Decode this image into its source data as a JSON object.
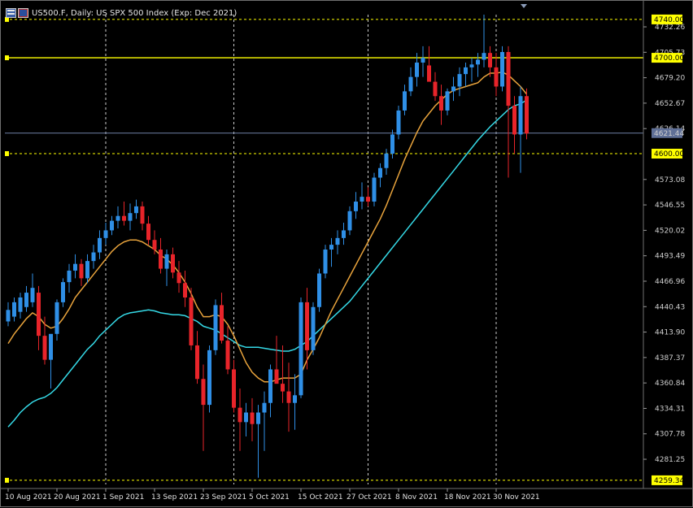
{
  "window": {
    "title": "US500.F, Daily:  US SPX 500 Index (Exp: Dec 2021)",
    "icon": "chart-window-icon"
  },
  "colors": {
    "background": "#000000",
    "bull_candle": "#2f8fe6",
    "bear_candle": "#e8242a",
    "ma_fast": "#e8a33c",
    "ma_slow": "#35d9e6",
    "level_line": "#ffff00",
    "grid": "#ffffff",
    "price_line": "#6f7fa6",
    "axis_text": "#cfcfcf"
  },
  "levels": [
    {
      "name": "level-4740",
      "value": 4740.0,
      "label": "4740.00",
      "style": "dashed"
    },
    {
      "name": "level-4700",
      "value": 4700.0,
      "label": "4700.00",
      "style": "solid"
    },
    {
      "name": "level-4600",
      "value": 4600.0,
      "label": "4600.00",
      "style": "dashed"
    },
    {
      "name": "level-4259",
      "value": 4259.34,
      "label": "4259.34",
      "style": "dashed"
    }
  ],
  "current_price": {
    "value": 4621.44,
    "label": "4621.44"
  },
  "chart_data": {
    "type": "candlestick",
    "title": "US500.F, Daily:  US SPX 500 Index (Exp: Dec 2021)",
    "grid": true,
    "ylim": [
      4255,
      4745
    ],
    "y_ticks": [
      "4732.26",
      "4705.73",
      "4679.20",
      "4652.67",
      "4626.14",
      "4573.08",
      "4546.55",
      "4520.02",
      "4493.49",
      "4466.96",
      "4440.43",
      "4413.90",
      "4387.37",
      "4360.84",
      "4334.31",
      "4307.78",
      "4281.25"
    ],
    "x_ticks": [
      "10 Aug 2021",
      "20 Aug 2021",
      "1 Sep 2021",
      "13 Sep 2021",
      "23 Sep 2021",
      "5 Oct 2021",
      "15 Oct 2021",
      "27 Oct 2021",
      "8 Nov 2021",
      "18 Nov 2021",
      "30 Nov 2021"
    ],
    "x_tick_index": [
      0,
      8,
      16,
      24,
      32,
      40,
      48,
      56,
      64,
      72,
      80
    ],
    "vertical_grid_index": [
      16,
      37,
      59,
      80
    ],
    "candles": [
      {
        "o": 4425,
        "h": 4445,
        "l": 4420,
        "c": 4437
      },
      {
        "o": 4430,
        "h": 4450,
        "l": 4425,
        "c": 4445
      },
      {
        "o": 4435,
        "h": 4455,
        "l": 4428,
        "c": 4450
      },
      {
        "o": 4440,
        "h": 4462,
        "l": 4435,
        "c": 4455
      },
      {
        "o": 4445,
        "h": 4475,
        "l": 4440,
        "c": 4460
      },
      {
        "o": 4455,
        "h": 4462,
        "l": 4395,
        "c": 4410
      },
      {
        "o": 4410,
        "h": 4430,
        "l": 4380,
        "c": 4385
      },
      {
        "o": 4385,
        "h": 4400,
        "l": 4355,
        "c": 4412
      },
      {
        "o": 4412,
        "h": 4448,
        "l": 4405,
        "c": 4445
      },
      {
        "o": 4445,
        "h": 4470,
        "l": 4440,
        "c": 4466
      },
      {
        "o": 4466,
        "h": 4485,
        "l": 4455,
        "c": 4478
      },
      {
        "o": 4478,
        "h": 4495,
        "l": 4470,
        "c": 4485
      },
      {
        "o": 4485,
        "h": 4490,
        "l": 4462,
        "c": 4470
      },
      {
        "o": 4470,
        "h": 4495,
        "l": 4465,
        "c": 4488
      },
      {
        "o": 4488,
        "h": 4505,
        "l": 4480,
        "c": 4497
      },
      {
        "o": 4497,
        "h": 4520,
        "l": 4490,
        "c": 4512
      },
      {
        "o": 4512,
        "h": 4528,
        "l": 4505,
        "c": 4520
      },
      {
        "o": 4520,
        "h": 4535,
        "l": 4515,
        "c": 4530
      },
      {
        "o": 4530,
        "h": 4545,
        "l": 4522,
        "c": 4535
      },
      {
        "o": 4535,
        "h": 4550,
        "l": 4525,
        "c": 4530
      },
      {
        "o": 4530,
        "h": 4548,
        "l": 4520,
        "c": 4538
      },
      {
        "o": 4538,
        "h": 4552,
        "l": 4532,
        "c": 4545
      },
      {
        "o": 4545,
        "h": 4550,
        "l": 4520,
        "c": 4527
      },
      {
        "o": 4527,
        "h": 4535,
        "l": 4505,
        "c": 4510
      },
      {
        "o": 4510,
        "h": 4520,
        "l": 4495,
        "c": 4500
      },
      {
        "o": 4500,
        "h": 4512,
        "l": 4475,
        "c": 4480
      },
      {
        "o": 4480,
        "h": 4500,
        "l": 4462,
        "c": 4495
      },
      {
        "o": 4495,
        "h": 4502,
        "l": 4470,
        "c": 4476
      },
      {
        "o": 4476,
        "h": 4488,
        "l": 4455,
        "c": 4465
      },
      {
        "o": 4465,
        "h": 4478,
        "l": 4440,
        "c": 4450
      },
      {
        "o": 4450,
        "h": 4460,
        "l": 4395,
        "c": 4400
      },
      {
        "o": 4400,
        "h": 4415,
        "l": 4360,
        "c": 4365
      },
      {
        "o": 4365,
        "h": 4380,
        "l": 4290,
        "c": 4338
      },
      {
        "o": 4338,
        "h": 4400,
        "l": 4330,
        "c": 4395
      },
      {
        "o": 4395,
        "h": 4448,
        "l": 4390,
        "c": 4442
      },
      {
        "o": 4442,
        "h": 4455,
        "l": 4402,
        "c": 4405
      },
      {
        "o": 4405,
        "h": 4420,
        "l": 4370,
        "c": 4375
      },
      {
        "o": 4375,
        "h": 4385,
        "l": 4330,
        "c": 4335
      },
      {
        "o": 4335,
        "h": 4355,
        "l": 4290,
        "c": 4320
      },
      {
        "o": 4320,
        "h": 4340,
        "l": 4305,
        "c": 4330
      },
      {
        "o": 4330,
        "h": 4345,
        "l": 4300,
        "c": 4318
      },
      {
        "o": 4318,
        "h": 4338,
        "l": 4262,
        "c": 4330
      },
      {
        "o": 4330,
        "h": 4352,
        "l": 4290,
        "c": 4340
      },
      {
        "o": 4340,
        "h": 4380,
        "l": 4325,
        "c": 4375
      },
      {
        "o": 4375,
        "h": 4410,
        "l": 4368,
        "c": 4360
      },
      {
        "o": 4360,
        "h": 4400,
        "l": 4340,
        "c": 4352
      },
      {
        "o": 4352,
        "h": 4382,
        "l": 4310,
        "c": 4340
      },
      {
        "o": 4340,
        "h": 4370,
        "l": 4312,
        "c": 4348
      },
      {
        "o": 4348,
        "h": 4450,
        "l": 4345,
        "c": 4445
      },
      {
        "o": 4445,
        "h": 4460,
        "l": 4375,
        "c": 4395
      },
      {
        "o": 4395,
        "h": 4445,
        "l": 4390,
        "c": 4440
      },
      {
        "o": 4440,
        "h": 4480,
        "l": 4435,
        "c": 4475
      },
      {
        "o": 4475,
        "h": 4505,
        "l": 4470,
        "c": 4500
      },
      {
        "o": 4500,
        "h": 4512,
        "l": 4482,
        "c": 4505
      },
      {
        "o": 4505,
        "h": 4520,
        "l": 4495,
        "c": 4512
      },
      {
        "o": 4512,
        "h": 4528,
        "l": 4505,
        "c": 4520
      },
      {
        "o": 4520,
        "h": 4545,
        "l": 4515,
        "c": 4540
      },
      {
        "o": 4540,
        "h": 4560,
        "l": 4532,
        "c": 4550
      },
      {
        "o": 4550,
        "h": 4570,
        "l": 4542,
        "c": 4555
      },
      {
        "o": 4555,
        "h": 4565,
        "l": 4545,
        "c": 4550
      },
      {
        "o": 4550,
        "h": 4580,
        "l": 4545,
        "c": 4575
      },
      {
        "o": 4575,
        "h": 4590,
        "l": 4565,
        "c": 4585
      },
      {
        "o": 4585,
        "h": 4605,
        "l": 4578,
        "c": 4600
      },
      {
        "o": 4600,
        "h": 4625,
        "l": 4595,
        "c": 4620
      },
      {
        "o": 4620,
        "h": 4650,
        "l": 4615,
        "c": 4645
      },
      {
        "o": 4645,
        "h": 4672,
        "l": 4640,
        "c": 4665
      },
      {
        "o": 4665,
        "h": 4690,
        "l": 4660,
        "c": 4680
      },
      {
        "o": 4680,
        "h": 4705,
        "l": 4670,
        "c": 4695
      },
      {
        "o": 4695,
        "h": 4712,
        "l": 4680,
        "c": 4700
      },
      {
        "o": 4692,
        "h": 4712,
        "l": 4682,
        "c": 4675
      },
      {
        "o": 4675,
        "h": 4685,
        "l": 4655,
        "c": 4660
      },
      {
        "o": 4660,
        "h": 4672,
        "l": 4630,
        "c": 4645
      },
      {
        "o": 4645,
        "h": 4668,
        "l": 4640,
        "c": 4665
      },
      {
        "o": 4665,
        "h": 4680,
        "l": 4655,
        "c": 4670
      },
      {
        "o": 4670,
        "h": 4690,
        "l": 4660,
        "c": 4683
      },
      {
        "o": 4683,
        "h": 4695,
        "l": 4670,
        "c": 4690
      },
      {
        "o": 4690,
        "h": 4700,
        "l": 4675,
        "c": 4693
      },
      {
        "o": 4693,
        "h": 4705,
        "l": 4680,
        "c": 4698
      },
      {
        "o": 4698,
        "h": 4745,
        "l": 4690,
        "c": 4705
      },
      {
        "o": 4705,
        "h": 4712,
        "l": 4680,
        "c": 4690
      },
      {
        "o": 4690,
        "h": 4705,
        "l": 4660,
        "c": 4670
      },
      {
        "o": 4670,
        "h": 4712,
        "l": 4665,
        "c": 4706
      },
      {
        "o": 4706,
        "h": 4712,
        "l": 4575,
        "c": 4650
      },
      {
        "o": 4650,
        "h": 4660,
        "l": 4600,
        "c": 4620
      },
      {
        "o": 4620,
        "h": 4670,
        "l": 4580,
        "c": 4660
      },
      {
        "o": 4660,
        "h": 4668,
        "l": 4615,
        "c": 4621
      }
    ],
    "ma_fast_values": [
      4402,
      4412,
      4420,
      4428,
      4434,
      4430,
      4422,
      4418,
      4420,
      4428,
      4438,
      4450,
      4458,
      4466,
      4474,
      4482,
      4490,
      4498,
      4504,
      4508,
      4510,
      4510,
      4508,
      4504,
      4500,
      4494,
      4490,
      4484,
      4476,
      4466,
      4454,
      4440,
      4430,
      4430,
      4432,
      4430,
      4422,
      4410,
      4396,
      4382,
      4372,
      4366,
      4362,
      4362,
      4364,
      4366,
      4366,
      4366,
      4370,
      4385,
      4396,
      4408,
      4422,
      4436,
      4448,
      4460,
      4472,
      4484,
      4496,
      4508,
      4520,
      4532,
      4546,
      4562,
      4578,
      4594,
      4608,
      4622,
      4634,
      4642,
      4650,
      4656,
      4662,
      4666,
      4668,
      4670,
      4672,
      4674,
      4680,
      4684,
      4684,
      4685,
      4682,
      4676,
      4670,
      4662
    ],
    "ma_slow_values": [
      4315,
      4322,
      4330,
      4336,
      4341,
      4344,
      4346,
      4350,
      4356,
      4364,
      4372,
      4380,
      4388,
      4396,
      4402,
      4410,
      4416,
      4422,
      4428,
      4432,
      4434,
      4435,
      4436,
      4437,
      4436,
      4434,
      4433,
      4432,
      4432,
      4431,
      4428,
      4425,
      4420,
      4418,
      4416,
      4412,
      4408,
      4404,
      4400,
      4398,
      4398,
      4398,
      4397,
      4396,
      4395,
      4394,
      4394,
      4396,
      4400,
      4404,
      4410,
      4416,
      4422,
      4428,
      4434,
      4440,
      4446,
      4454,
      4462,
      4470,
      4478,
      4486,
      4494,
      4502,
      4510,
      4518,
      4526,
      4534,
      4542,
      4550,
      4558,
      4566,
      4574,
      4582,
      4590,
      4598,
      4606,
      4614,
      4621,
      4628,
      4634,
      4640,
      4646,
      4650,
      4652,
      4656
    ]
  }
}
